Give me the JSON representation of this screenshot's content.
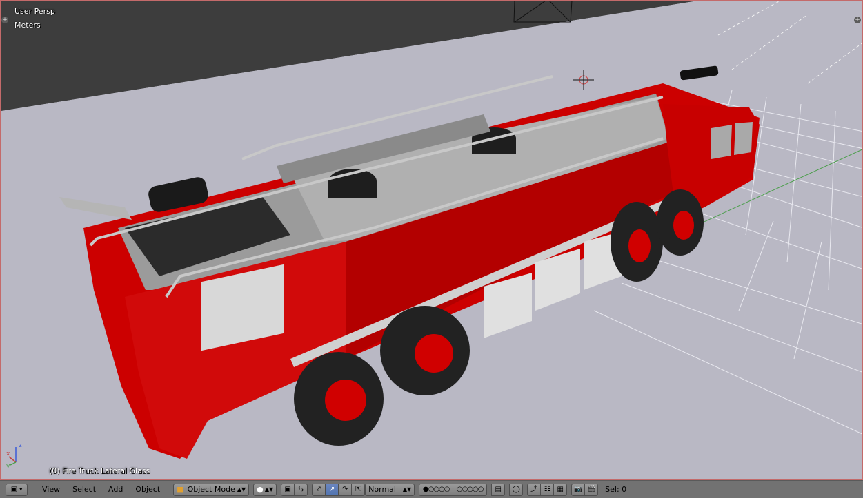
{
  "viewport": {
    "view_name": "User Persp",
    "units": "Meters",
    "active_object": "(0) Fire Truck Lateral Glass",
    "axes": {
      "x": "x",
      "y": "y",
      "z": "z"
    }
  },
  "header": {
    "editor_type_icon": "3d-viewport-icon",
    "menus": [
      "View",
      "Select",
      "Add",
      "Object"
    ],
    "mode": "Object Mode",
    "shading_icon": "solid-shading-icon",
    "pivot_icon": "pivot-point-icon",
    "manipulator_icons": [
      "manipulator-toggle-icon",
      "translate-icon",
      "rotate-icon",
      "scale-icon"
    ],
    "orientation": "Normal",
    "layers_icon": "layers-icon",
    "tool_icons": [
      "lock-camera-icon",
      "proportional-edit-icon",
      "snap-icon",
      "snap-element-icon",
      "snap-target-icon",
      "render-icon",
      "render-animation-icon"
    ],
    "selection_status": "Sel: 0"
  },
  "colors": {
    "viewport_bg": "#b9b8c4",
    "horizon_dark": "#3d3d3d",
    "header_bg": "#727272",
    "truck_red": "#d40000",
    "grid_line": "#e8e8ee",
    "x_axis": "#c44040",
    "y_axis": "#4a9e4a"
  }
}
